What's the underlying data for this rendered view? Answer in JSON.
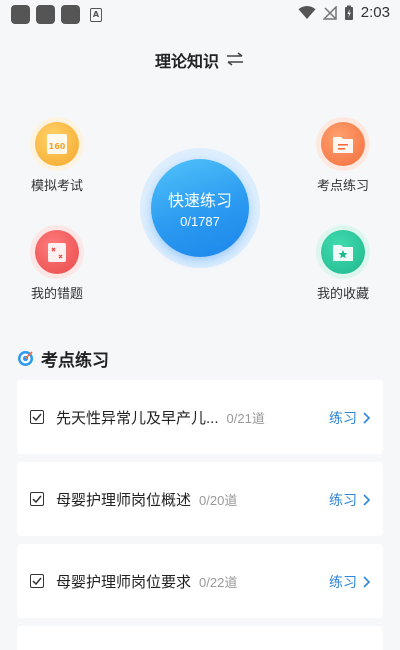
{
  "status_bar": {
    "time": "2:03"
  },
  "header": {
    "title": "理论知识"
  },
  "quick": {
    "mock_exam": "模拟考试",
    "point_practice": "考点练习",
    "wrong_questions": "我的错题",
    "favorites": "我的收藏",
    "quick_practice": {
      "label": "快速练习",
      "progress": "0/1787"
    }
  },
  "section": {
    "title": "考点练习",
    "items": [
      {
        "name": "先天性异常儿及早产儿...",
        "count": "0/21道",
        "action": "练习"
      },
      {
        "name": "母婴护理师岗位概述",
        "count": "0/20道",
        "action": "练习"
      },
      {
        "name": "母婴护理师岗位要求",
        "count": "0/22道",
        "action": "练习"
      }
    ]
  },
  "colors": {
    "accent": "#2f86d6",
    "quick_blue": "#2b9af0"
  }
}
